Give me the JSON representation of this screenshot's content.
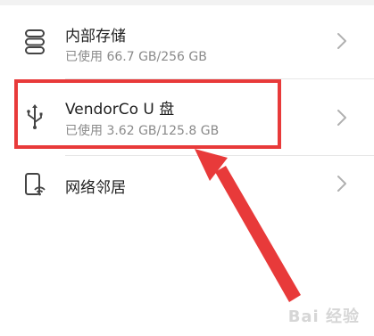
{
  "storage_list": {
    "items": [
      {
        "title": "内部存储",
        "subtitle": "已使用 66.7 GB/256 GB",
        "icon": "storage-icon"
      },
      {
        "title": "VendorCo U 盘",
        "subtitle": "已使用 3.62 GB/125.8 GB",
        "icon": "usb-icon"
      },
      {
        "title": "网络邻居",
        "icon": "network-device-icon"
      }
    ]
  },
  "annotation": {
    "highlight_color": "#e83a3a",
    "arrow_color": "#e83a3a"
  },
  "watermark": {
    "text": "Bai 经验"
  }
}
